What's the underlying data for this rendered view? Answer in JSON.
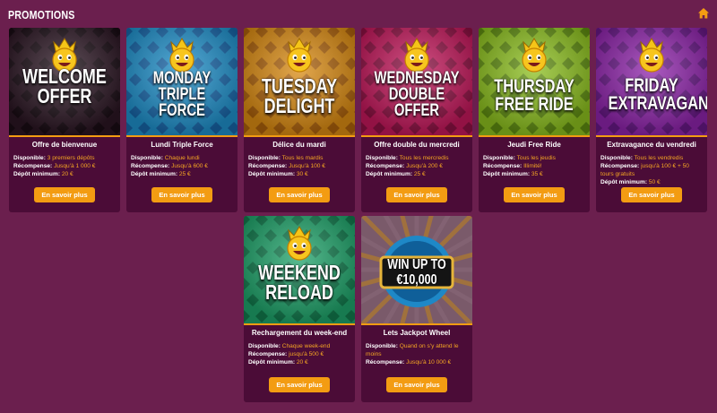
{
  "page": {
    "title": "PROMOTIONS",
    "home_icon": "home-icon"
  },
  "colors": {
    "background": "#6b1f4e",
    "card": "#4b0c37",
    "accent": "#f39c12",
    "highlight": "#f5a623"
  },
  "promos": [
    {
      "headline": "WELCOME\nOFFER",
      "title": "Offre de bienvenue",
      "rows": [
        {
          "label": "Disponible:",
          "value": "3 premiers dépôts"
        },
        {
          "label": "Récompense:",
          "value": "Jusqu'à 1 000 €"
        },
        {
          "label": "Dépôt minimum:",
          "value": "20 €"
        }
      ],
      "button": "En savoir plus",
      "theme": {
        "bg": "#2b1623",
        "pattern": "#140a10"
      }
    },
    {
      "headline": "MONDAY\nTRIPLE\nFORCE",
      "title": "Lundi Triple Force",
      "rows": [
        {
          "label": "Disponible:",
          "value": "Chaque lundi"
        },
        {
          "label": "Récompense:",
          "value": "Jusqu'à 600 €"
        },
        {
          "label": "Dépôt minimum:",
          "value": "25 €"
        }
      ],
      "button": "En savoir plus",
      "theme": {
        "bg": "#1f8fc9",
        "pattern": "#15569a"
      }
    },
    {
      "headline": "TUESDAY\nDELIGHT",
      "title": "Délice du mardi",
      "rows": [
        {
          "label": "Disponible:",
          "value": "Tous les mardis"
        },
        {
          "label": "Récompense:",
          "value": "Jusqu'à 100 €"
        },
        {
          "label": "Dépôt minimum:",
          "value": "30 €"
        }
      ],
      "button": "En savoir plus",
      "theme": {
        "bg": "#d98a12",
        "pattern": "#9a520a"
      }
    },
    {
      "headline": "WEDNESDAY\nDOUBLE\nOFFER",
      "title": "Offre double du mercredi",
      "rows": [
        {
          "label": "Disponible:",
          "value": "Tous les mercredis"
        },
        {
          "label": "Récompense:",
          "value": "Jusqu'à 200 €"
        },
        {
          "label": "Dépôt minimum:",
          "value": "25 €"
        }
      ],
      "button": "En savoir plus",
      "theme": {
        "bg": "#c2185b",
        "pattern": "#7a0d3a"
      }
    },
    {
      "headline": "THURSDAY\nFREE RIDE",
      "title": "Jeudi Free Ride",
      "rows": [
        {
          "label": "Disponible:",
          "value": "Tous les jeudis"
        },
        {
          "label": "Récompense:",
          "value": "Illimité!"
        },
        {
          "label": "Dépôt minimum:",
          "value": "35 €"
        }
      ],
      "button": "En savoir plus",
      "theme": {
        "bg": "#8cbf1f",
        "pattern": "#4f7a0c"
      }
    },
    {
      "headline": "FRIDAY\nEXTRAVAGANZA",
      "title": "Extravagance du vendredi",
      "rows": [
        {
          "label": "Disponible:",
          "value": "Tous les vendredis"
        },
        {
          "label": "Récompense:",
          "value": "jusqu'à 100 € + 50 tours gratuits"
        },
        {
          "label": "Dépôt minimum:",
          "value": "50 €"
        }
      ],
      "button": "En savoir plus",
      "theme": {
        "bg": "#8e24aa",
        "pattern": "#5a1478"
      }
    },
    {
      "headline": "WEEKEND\nRELOAD",
      "title": "Rechargement du week-end",
      "rows": [
        {
          "label": "Disponible:",
          "value": "Chaque week-end"
        },
        {
          "label": "Récompense:",
          "value": "jusqu'à 500 €"
        },
        {
          "label": "Dépôt minimum:",
          "value": "20 €"
        }
      ],
      "button": "En savoir plus",
      "theme": {
        "bg": "#1fa36a",
        "pattern": "#0d6b43"
      }
    },
    {
      "headline": "WIN UP TO\n€10,000",
      "title": "Lets Jackpot Wheel",
      "rows": [
        {
          "label": "Disponible:",
          "value": "Quand on s'y attend le moins"
        },
        {
          "label": "Récompense:",
          "value": "Jusqu'à 10 000 €"
        }
      ],
      "button": "En savoir plus",
      "theme": {
        "bg": "#7a5a6a",
        "pattern": "#c0841a"
      }
    }
  ]
}
